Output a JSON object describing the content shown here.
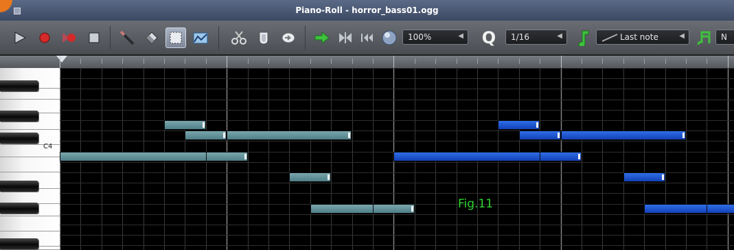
{
  "window": {
    "title": "Piano-Roll - horror_bass01.ogg"
  },
  "toolbar": {
    "buttons": [
      {
        "name": "play-button",
        "icon": "play-icon"
      },
      {
        "name": "record-button",
        "icon": "record-icon"
      },
      {
        "name": "record-while-playing-button",
        "icon": "record-play-icon"
      },
      {
        "name": "stop-button",
        "icon": "stop-icon"
      },
      {
        "name": "draw-mode-button",
        "icon": "pencil-icon"
      },
      {
        "name": "erase-mode-button",
        "icon": "eraser-icon"
      },
      {
        "name": "select-mode-button",
        "icon": "select-icon",
        "active": true
      },
      {
        "name": "detune-mode-button",
        "icon": "detune-icon"
      },
      {
        "name": "cut-button",
        "icon": "scissors-icon"
      },
      {
        "name": "copy-button",
        "icon": "copy-icon"
      },
      {
        "name": "paste-button",
        "icon": "paste-icon"
      },
      {
        "name": "autoscroll-button",
        "icon": "arrow-right-icon"
      },
      {
        "name": "loop-points-button",
        "icon": "loop-points-icon"
      },
      {
        "name": "stop-behaviour-button",
        "icon": "rewind-start-icon"
      }
    ],
    "zoom": {
      "icon": "zoom-icon",
      "value": "100%"
    },
    "quantize": {
      "label": "Q",
      "value": "1/16"
    },
    "note_length": {
      "icon": "note-length-icon",
      "value": "Last note"
    },
    "scale": {
      "icon": "scale-icon",
      "value": "N"
    }
  },
  "piano": {
    "c4_label": "C4"
  },
  "notes": [
    {
      "row": 8,
      "col": 0,
      "len": 8,
      "color": "teal"
    },
    {
      "row": 5,
      "col": 5,
      "len": 2,
      "color": "teal"
    },
    {
      "row": 6,
      "col": 6,
      "len": 2,
      "color": "teal"
    },
    {
      "row": 8,
      "col": 7,
      "len": 2,
      "color": "teal"
    },
    {
      "row": 6,
      "col": 8,
      "len": 6,
      "color": "teal"
    },
    {
      "row": 10,
      "col": 11,
      "len": 2,
      "color": "teal"
    },
    {
      "row": 13,
      "col": 12,
      "len": 4,
      "color": "teal"
    },
    {
      "row": 13,
      "col": 15,
      "len": 2,
      "color": "teal"
    },
    {
      "row": 8,
      "col": 16,
      "len": 8,
      "color": "blue"
    },
    {
      "row": 5,
      "col": 21,
      "len": 2,
      "color": "blue"
    },
    {
      "row": 6,
      "col": 22,
      "len": 2,
      "color": "blue"
    },
    {
      "row": 8,
      "col": 23,
      "len": 2,
      "color": "blue"
    },
    {
      "row": 6,
      "col": 24,
      "len": 6,
      "color": "blue"
    },
    {
      "row": 10,
      "col": 27,
      "len": 2,
      "color": "blue"
    },
    {
      "row": 13,
      "col": 28,
      "len": 4,
      "color": "blue"
    },
    {
      "row": 13,
      "col": 31,
      "len": 2,
      "color": "blue"
    }
  ],
  "annotation": {
    "text": "Fig.11"
  },
  "colors": {
    "teal_note": "#5e9098",
    "blue_note": "#1d56d6",
    "fig_label": "#2fd22f"
  }
}
